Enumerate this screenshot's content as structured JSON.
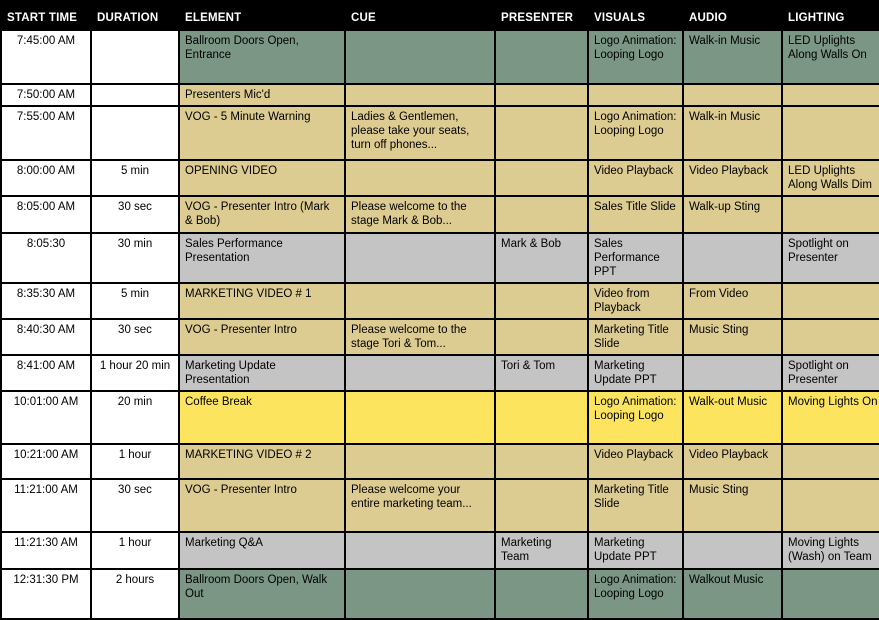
{
  "table": {
    "columns": [
      {
        "key": "start_time",
        "label": "START TIME"
      },
      {
        "key": "duration",
        "label": "DURATION"
      },
      {
        "key": "element",
        "label": "ELEMENT"
      },
      {
        "key": "cue",
        "label": "CUE"
      },
      {
        "key": "presenter",
        "label": "PRESENTER"
      },
      {
        "key": "visuals",
        "label": "VISUALS"
      },
      {
        "key": "audio",
        "label": "AUDIO"
      },
      {
        "key": "lighting",
        "label": "LIGHTING"
      }
    ],
    "colors": {
      "header_background": "#000000",
      "header_text": "#ffffff",
      "grid_lines": "#000000",
      "fill_white": "#ffffff",
      "fill_tan": "#ddcc92",
      "fill_green": "#7b9685",
      "fill_gray": "#c4c4c4",
      "fill_yellow": "#fce45f",
      "text_dark": "#101010",
      "text_white": "#ffffff",
      "text_blue": "#2a2ab8"
    },
    "rows": [
      {
        "start_time": "7:45:00 AM",
        "duration": "",
        "element": "Ballroom Doors Open, Entrance",
        "cue": "",
        "presenter": "",
        "visuals": "Logo Animation: Looping Logo",
        "audio": "Walk-in Music",
        "lighting": "LED Uplights Along Walls On",
        "fill": "green",
        "text": "white",
        "height": 52
      },
      {
        "start_time": "7:50:00 AM",
        "duration": "",
        "element": "Presenters Mic'd",
        "cue": "",
        "presenter": "",
        "visuals": "",
        "audio": "",
        "lighting": "",
        "fill": "tan",
        "text": "dark",
        "height": 20
      },
      {
        "start_time": "7:55:00 AM",
        "duration": "",
        "element": "VOG - 5 Minute Warning",
        "cue": "Ladies & Gentlemen, please take your seats, turn off phones...",
        "presenter": "",
        "visuals": "Logo Animation: Looping Logo",
        "audio": "Walk-in Music",
        "lighting": "",
        "fill": "tan",
        "text": "dark",
        "height": 52
      },
      {
        "start_time": "8:00:00 AM",
        "duration": "5 min",
        "element": "OPENING VIDEO",
        "cue": "",
        "presenter": "",
        "visuals": "Video Playback",
        "audio": "Video Playback",
        "lighting": "LED Uplights Along Walls Dim",
        "fill": "tan",
        "text": "dark",
        "height": 33
      },
      {
        "start_time": "8:05:00 AM",
        "duration": "30 sec",
        "element": "VOG - Presenter Intro (Mark & Bob)",
        "cue": "Please welcome to the stage Mark & Bob...",
        "presenter": "",
        "visuals": "Sales Title Slide",
        "audio": "Walk-up Sting",
        "lighting": "",
        "fill": "tan",
        "text": "dark",
        "height": 35
      },
      {
        "start_time": "8:05:30",
        "duration": "30 min",
        "element": "Sales Performance Presentation",
        "cue": "",
        "presenter": "Mark & Bob",
        "visuals": "Sales Performance PPT",
        "audio": "",
        "lighting": "Spotlight on Presenter",
        "fill": "gray",
        "text": "blue",
        "height": 47
      },
      {
        "start_time": "8:35:30 AM",
        "duration": "5 min",
        "element": "MARKETING VIDEO # 1",
        "cue": "",
        "presenter": "",
        "visuals": "Video from Playback",
        "audio": "From Video",
        "lighting": "",
        "fill": "tan",
        "text": "dark",
        "height": 33
      },
      {
        "start_time": "8:40:30 AM",
        "duration": "30 sec",
        "element": "VOG - Presenter Intro",
        "cue": "Please welcome to the stage Tori & Tom...",
        "presenter": "",
        "visuals": "Marketing Title Slide",
        "audio": "Music Sting",
        "lighting": "",
        "fill": "tan",
        "text": "dark",
        "height": 33
      },
      {
        "start_time": "8:41:00 AM",
        "duration": "1 hour 20 min",
        "element": "Marketing Update Presentation",
        "cue": "",
        "presenter": "Tori & Tom",
        "visuals": "Marketing Update PPT",
        "audio": "",
        "lighting": "Spotlight on Presenter",
        "fill": "gray",
        "text": "blue",
        "height": 34
      },
      {
        "start_time": "10:01:00 AM",
        "duration": "20 min",
        "element": "Coffee Break",
        "cue": "",
        "presenter": "",
        "visuals": "Logo Animation: Looping Logo",
        "audio": "Walk-out Music",
        "lighting": "Moving Lights On",
        "fill": "yellow",
        "text": "dark",
        "height": 51
      },
      {
        "start_time": "10:21:00 AM",
        "duration": "1 hour",
        "element": "MARKETING VIDEO # 2",
        "cue": "",
        "presenter": "",
        "visuals": "Video Playback",
        "audio": "Video Playback",
        "lighting": "",
        "fill": "tan",
        "text": "dark",
        "height": 33
      },
      {
        "start_time": "11:21:00 AM",
        "duration": "30 sec",
        "element": "VOG - Presenter Intro",
        "cue": "Please welcome your entire marketing team...",
        "presenter": "",
        "visuals": "Marketing Title Slide",
        "audio": "Music Sting",
        "lighting": "",
        "fill": "tan",
        "text": "dark",
        "height": 51
      },
      {
        "start_time": "11:21:30 AM",
        "duration": "1 hour",
        "element": "Marketing Q&A",
        "cue": "",
        "presenter": "Marketing Team",
        "visuals": "Marketing Update PPT",
        "audio": "",
        "lighting": "Moving Lights (Wash) on Team",
        "fill": "gray",
        "text": "blue",
        "height": 35
      },
      {
        "start_time": "12:31:30 PM",
        "duration": "2 hours",
        "element": "Ballroom Doors Open, Walk Out",
        "cue": "",
        "presenter": "",
        "visuals": "Logo Animation: Looping Logo",
        "audio": "Walkout Music",
        "lighting": "",
        "fill": "green",
        "text": "white",
        "height": 48
      }
    ]
  }
}
